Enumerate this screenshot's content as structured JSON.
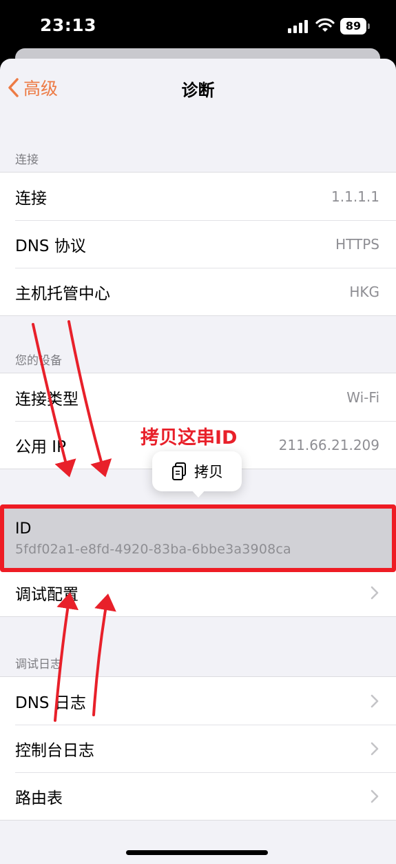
{
  "status_bar": {
    "time": "23:13",
    "battery": "89"
  },
  "nav": {
    "back_label": "高级",
    "title": "诊断"
  },
  "sections": {
    "connection": {
      "header": "连接",
      "rows": [
        {
          "label": "连接",
          "value": "1.1.1.1"
        },
        {
          "label": "DNS 协议",
          "value": "HTTPS"
        },
        {
          "label": "主机托管中心",
          "value": "HKG"
        }
      ]
    },
    "device": {
      "header": "您的设备",
      "rows": [
        {
          "label": "连接类型",
          "value": "Wi-Fi"
        },
        {
          "label": "公用 IP",
          "value": "211.66.21.209"
        }
      ],
      "id_row": {
        "label": "ID",
        "value": "5fdf02a1-e8fd-4920-83ba-6bbe3a3908ca"
      },
      "debug_config": {
        "label": "调试配置"
      }
    },
    "debug_logs": {
      "header": "调试日志",
      "rows": [
        {
          "label": "DNS 日志"
        },
        {
          "label": "控制台日志"
        },
        {
          "label": "路由表"
        }
      ]
    }
  },
  "popup": {
    "copy_label": "拷贝"
  },
  "annotation": {
    "text": "拷贝这串ID",
    "color": "#ee1c24"
  },
  "colors": {
    "accent": "#ed7b45",
    "secondary_text": "#8e8e93",
    "background": "#f2f2f7"
  }
}
